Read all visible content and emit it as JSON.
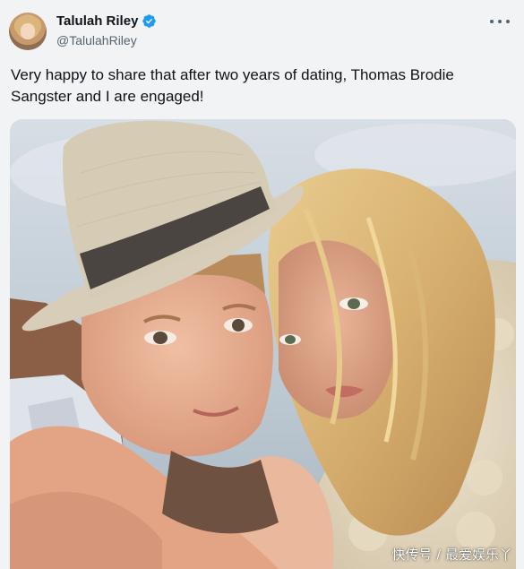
{
  "author": {
    "display_name": "Talulah Riley",
    "handle": "@TalulahRiley",
    "verified": true,
    "icons": [
      "avatar-photo",
      "verified-badge-icon",
      "more-options-icon"
    ]
  },
  "tweet": {
    "text": "Very happy to share that after two years of dating, Thomas Brodie Sangster and I are engaged!"
  },
  "media": {
    "watermark": "快传号 / 最爱娱乐丫"
  },
  "colors": {
    "background": "#f2f3f5",
    "text_primary": "#0f1419",
    "text_secondary": "#536471",
    "verified_blue": "#1d9bf0"
  }
}
